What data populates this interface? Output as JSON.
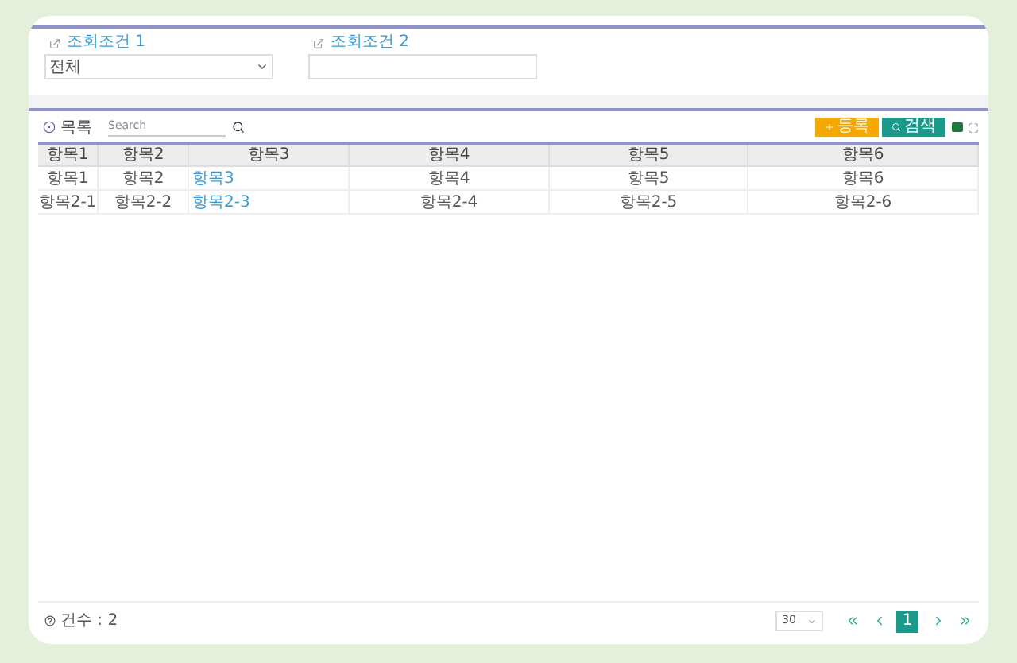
{
  "filters": [
    {
      "label": "조회조건 1",
      "kind": "select",
      "value": "전체"
    },
    {
      "label": "조회조건 2",
      "kind": "text"
    }
  ],
  "list": {
    "title": "목록",
    "search": {
      "placeholder": "Search"
    },
    "buttons": [
      {
        "label": "등록",
        "kind": "add"
      },
      {
        "label": "검색",
        "kind": "search"
      }
    ]
  },
  "table": {
    "columns": [
      "항목1",
      "항목2",
      "항목3",
      "항목4",
      "항목5",
      "항목6"
    ],
    "rows": [
      [
        {
          "text": "항목1",
          "link": false
        },
        {
          "text": "항목2",
          "link": false
        },
        {
          "text": "항목3",
          "link": true
        },
        {
          "text": "항목4",
          "link": false
        },
        {
          "text": "항목5",
          "link": false
        },
        {
          "text": "항목6",
          "link": false
        }
      ],
      [
        {
          "text": "항목2-1",
          "link": false
        },
        {
          "text": "항목2-2",
          "link": false
        },
        {
          "text": "항목2-3",
          "link": true
        },
        {
          "text": "항목2-4",
          "link": false
        },
        {
          "text": "항목2-5",
          "link": false
        },
        {
          "text": "항목2-6",
          "link": false
        }
      ]
    ]
  },
  "footer": {
    "count": "건수 : 2",
    "page_size": "30",
    "pages": [
      {
        "label": "1",
        "selected": true
      }
    ]
  }
}
